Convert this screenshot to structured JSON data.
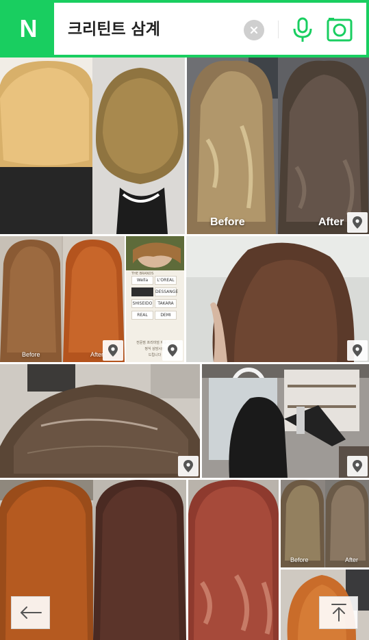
{
  "search": {
    "logo": "N",
    "query": "크리틴트 삼계"
  },
  "icons": {
    "clear": "clear-icon",
    "mic": "microphone-icon",
    "lens": "camera-lens-icon",
    "pin": "map-pin-icon",
    "back": "arrow-left-icon",
    "top": "arrow-up-to-top-icon"
  },
  "colors": {
    "brand": "#19ce60",
    "pin": "#555555"
  },
  "tiles": [
    {
      "id": "blonde-bob",
      "caption_left": "",
      "caption_right": ""
    },
    {
      "id": "long-waves",
      "caption_left": "Before",
      "caption_right": "After"
    },
    {
      "id": "copper-long",
      "caption_left": "Before",
      "caption_right": "After"
    },
    {
      "id": "product-ad",
      "caption_left": "",
      "caption_right": ""
    },
    {
      "id": "brown-side",
      "caption_left": "",
      "caption_right": ""
    },
    {
      "id": "scalp-closeup",
      "caption_left": "",
      "caption_right": ""
    },
    {
      "id": "salon-interior",
      "caption_left": "",
      "caption_right": ""
    },
    {
      "id": "orange-long",
      "caption_left": "",
      "caption_right": ""
    },
    {
      "id": "rose-waves",
      "caption_left": "",
      "caption_right": ""
    },
    {
      "id": "mini-before-after",
      "caption_left": "Before",
      "caption_right": "After"
    },
    {
      "id": "copper-bottom",
      "caption_left": "",
      "caption_right": ""
    }
  ],
  "ad": {
    "header": "THE BRANDS",
    "brands": [
      "Wella",
      "L'OREAL",
      "",
      "DESSANGE",
      "SHISEIDO",
      "TAKARA",
      "REAL",
      "DEMI"
    ],
    "footer": [
      "전문점 프리미엄 제품사용",
      "정식 상담시술",
      "드립니다"
    ]
  }
}
